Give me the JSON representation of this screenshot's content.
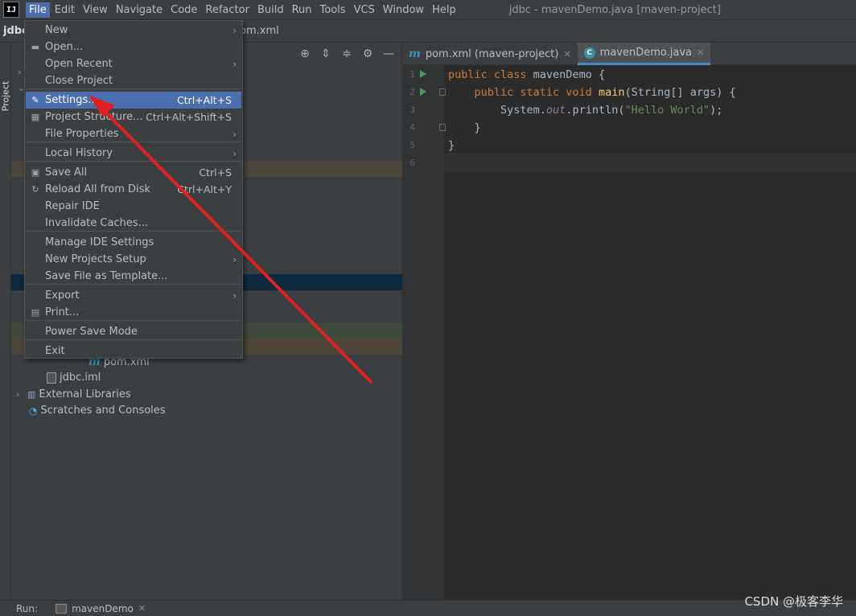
{
  "menubar": {
    "logo": "IJ",
    "items": [
      "File",
      "Edit",
      "View",
      "Navigate",
      "Code",
      "Refactor",
      "Build",
      "Run",
      "Tools",
      "VCS",
      "Window",
      "Help"
    ],
    "title": "jdbc - mavenDemo.java [maven-project]"
  },
  "navbar": {
    "project": "jdbc",
    "file": "om.xml"
  },
  "left_strip": {
    "label": "Project"
  },
  "project_tree": {
    "rows": [
      {
        "label": "pom.xml",
        "icon": "maven-icon"
      },
      {
        "label": "jdbc.iml",
        "icon": "iml-file-icon"
      },
      {
        "label": "External Libraries",
        "icon": "libraries-icon"
      },
      {
        "label": "Scratches and Consoles",
        "icon": "scratches-icon"
      }
    ]
  },
  "editor_tabs": [
    {
      "label": "pom.xml (maven-project)",
      "icon": "maven-icon",
      "selected": false
    },
    {
      "label": "mavenDemo.java",
      "icon": "java-class-icon",
      "selected": true
    }
  ],
  "editor": {
    "line_numbers": [
      "1",
      "2",
      "3",
      "4",
      "5",
      "6"
    ],
    "lines": [
      [
        {
          "t": "public class ",
          "c": "kw"
        },
        {
          "t": "mavenDemo {",
          "c": ""
        }
      ],
      [
        {
          "t": "    public static void ",
          "c": "kw"
        },
        {
          "t": "main",
          "c": "fn"
        },
        {
          "t": "(String[] args) {",
          "c": ""
        }
      ],
      [
        {
          "t": "        System.",
          "c": ""
        },
        {
          "t": "out",
          "c": "it"
        },
        {
          "t": ".println(",
          "c": ""
        },
        {
          "t": "\"Hello World\"",
          "c": "str"
        },
        {
          "t": ");",
          "c": ""
        }
      ],
      [
        {
          "t": "    }",
          "c": ""
        }
      ],
      [
        {
          "t": "}",
          "c": ""
        }
      ],
      [
        {
          "t": "",
          "c": ""
        }
      ]
    ]
  },
  "file_menu": {
    "items": [
      {
        "label": "New",
        "shortcut": "",
        "submenu": true,
        "icon": ""
      },
      {
        "label": "Open...",
        "shortcut": "",
        "submenu": false,
        "icon": "folder-icon"
      },
      {
        "label": "Open Recent",
        "shortcut": "",
        "submenu": true,
        "icon": ""
      },
      {
        "label": "Close Project",
        "shortcut": "",
        "submenu": false,
        "icon": ""
      },
      {
        "label": "Settings...",
        "shortcut": "Ctrl+Alt+S",
        "submenu": false,
        "icon": "wrench-icon",
        "selected": true
      },
      {
        "label": "Project Structure...",
        "shortcut": "Ctrl+Alt+Shift+S",
        "submenu": false,
        "icon": "project-structure-icon"
      },
      {
        "label": "File Properties",
        "shortcut": "",
        "submenu": true,
        "icon": ""
      },
      {
        "label": "Local History",
        "shortcut": "",
        "submenu": true,
        "icon": ""
      },
      {
        "label": "Save All",
        "shortcut": "Ctrl+S",
        "submenu": false,
        "icon": "save-icon"
      },
      {
        "label": "Reload All from Disk",
        "shortcut": "Ctrl+Alt+Y",
        "submenu": false,
        "icon": "reload-icon"
      },
      {
        "label": "Repair IDE",
        "shortcut": "",
        "submenu": false,
        "icon": ""
      },
      {
        "label": "Invalidate Caches...",
        "shortcut": "",
        "submenu": false,
        "icon": ""
      },
      {
        "label": "Manage IDE Settings",
        "shortcut": "",
        "submenu": true,
        "icon": ""
      },
      {
        "label": "New Projects Setup",
        "shortcut": "",
        "submenu": true,
        "icon": ""
      },
      {
        "label": "Save File as Template...",
        "shortcut": "",
        "submenu": false,
        "icon": ""
      },
      {
        "label": "Export",
        "shortcut": "",
        "submenu": true,
        "icon": ""
      },
      {
        "label": "Print...",
        "shortcut": "",
        "submenu": false,
        "icon": "print-icon"
      },
      {
        "label": "Power Save Mode",
        "shortcut": "",
        "submenu": false,
        "icon": ""
      },
      {
        "label": "Exit",
        "shortcut": "",
        "submenu": false,
        "icon": ""
      }
    ]
  },
  "bottom_bar": {
    "run_label": "Run:",
    "run_tab": "mavenDemo"
  },
  "watermark": "CSDN @极客李华",
  "colors": {
    "accent": "#4b6eaf",
    "annotation_arrow": "#e0201e"
  }
}
